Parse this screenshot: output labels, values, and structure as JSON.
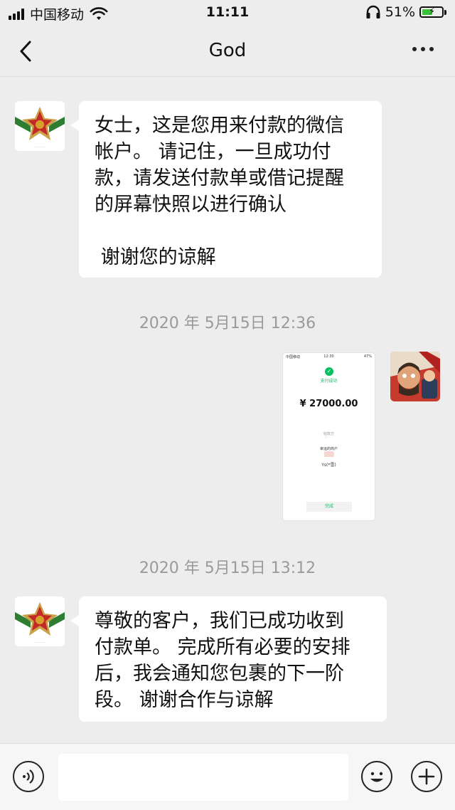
{
  "status_bar": {
    "carrier": "中国移动",
    "time": "11:11",
    "battery_percent": "51%",
    "battery_level": 0.51,
    "icons": [
      "signal-icon",
      "wifi-icon",
      "headphones-icon",
      "battery-charging-icon"
    ]
  },
  "nav": {
    "title": "God",
    "back_icon": "chevron-left-icon",
    "more_icon": "more-dots-icon"
  },
  "messages": [
    {
      "direction": "received",
      "avatar": "emblem-avatar",
      "text": "女士，这是您用来付款的微信\n帐户。 请记住，一旦成功付\n款，请发送付款单或借记提醒\n的屏幕快照以进行确认\n\n 谢谢您的谅解"
    },
    {
      "direction": "sent",
      "avatar": "cartoon-avatar",
      "image": {
        "status_carrier": "中国移动",
        "status_time": "12:30",
        "status_battery": "47%",
        "success_text": "支付成功",
        "amount": "¥ 27000.00",
        "payee_label": "收款方",
        "merchant": "幸运的商户",
        "payer": "Ys(*雪)",
        "done_button": "完成"
      }
    },
    {
      "direction": "received",
      "avatar": "emblem-avatar",
      "text": "尊敬的客户，我们已成功收到\n付款单。 完成所有必要的安排\n后，我会通知您包裹的下一阶\n段。 谢谢合作与谅解"
    }
  ],
  "timestamps": [
    "2020 年 5月15日 12:36",
    "2020 年 5月15日 13:12"
  ],
  "input_bar": {
    "voice_icon": "voice-icon",
    "text_value": "",
    "emoji_icon": "emoji-icon",
    "plus_icon": "plus-icon"
  },
  "colors": {
    "background": "#ededed",
    "bubble": "#ffffff",
    "wechat_green": "#07c160",
    "timestamp_text": "#9a9a9a"
  }
}
